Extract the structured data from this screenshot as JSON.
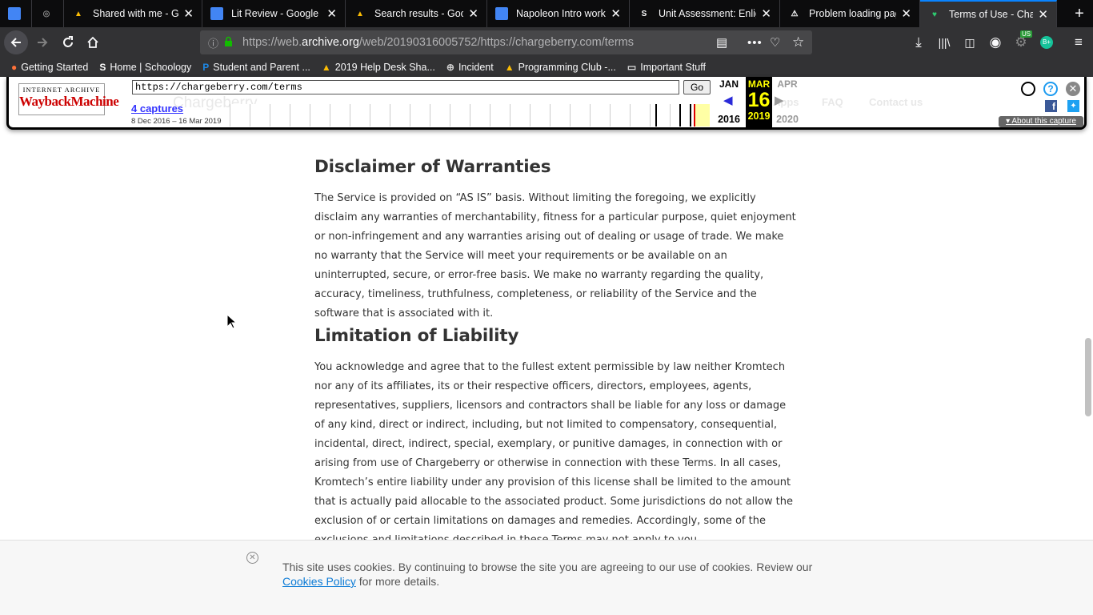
{
  "tabs": [
    {
      "title": "",
      "icon": "docs-icon",
      "color": "#4285f4"
    },
    {
      "title": "",
      "icon": "circle-logo-icon",
      "color": "#888"
    },
    {
      "title": "Shared with me - Goog",
      "icon": "drive-icon",
      "color": "#fbbc04"
    },
    {
      "title": "Lit Review - Google Do",
      "icon": "docs-icon",
      "color": "#4285f4"
    },
    {
      "title": "Search results - Googl",
      "icon": "drive-icon",
      "color": "#fbbc04"
    },
    {
      "title": "Napoleon Intro worksh",
      "icon": "docs-icon",
      "color": "#4285f4"
    },
    {
      "title": "Unit Assessment: Enlig",
      "icon": "schoology-icon",
      "color": "#fff"
    },
    {
      "title": "Problem loading page",
      "icon": "warning-icon",
      "color": "#fff"
    },
    {
      "title": "Terms of Use - Charge",
      "icon": "chargeberry-icon",
      "color": "#2ecc71"
    }
  ],
  "address": {
    "prefix": "https://web.",
    "domain": "archive.org",
    "suffix": "/web/20190316005752/https://chargeberry.com/terms"
  },
  "bookmarks": [
    {
      "label": "Getting Started",
      "icon": "firefox-icon",
      "color": "#ff7139"
    },
    {
      "label": "Home | Schoology",
      "icon": "schoology-icon",
      "color": "#fff"
    },
    {
      "label": "Student and Parent ...",
      "icon": "p-icon",
      "color": "#1e88e5"
    },
    {
      "label": "2019 Help Desk Sha...",
      "icon": "drive-icon",
      "color": "#fbbc04"
    },
    {
      "label": "Incident",
      "icon": "globe-icon",
      "color": "#ccc"
    },
    {
      "label": "Programming Club -...",
      "icon": "drive-icon",
      "color": "#fbbc04"
    },
    {
      "label": "Important Stuff",
      "icon": "folder-icon",
      "color": "#ddd"
    }
  ],
  "extension_badge": "US",
  "wayback": {
    "logo_line1": "INTERNET ARCHIVE",
    "logo_line2": "WaybackMachine",
    "url_value": "https://chargeberry.com/terms",
    "go": "Go",
    "captures": "4 captures",
    "capture_range": "8 Dec 2016 – 16 Mar 2019",
    "prev_month": "JAN",
    "cur_month": "MAR",
    "next_month": "APR",
    "day": "16",
    "prev_year": "2016",
    "cur_year": "2019",
    "next_year": "2020",
    "about": "About this capture",
    "ghost_brand": "Chargeberry",
    "ghost_nav": [
      "Apps",
      "FAQ",
      "Contact us"
    ]
  },
  "content": {
    "h1": "Disclaimer of Warranties",
    "p1": "The Service is provided on “AS IS” basis. Without limiting the foregoing, we explicitly disclaim any warranties of merchantability, fitness for a particular purpose, quiet enjoyment or non-infringement and any warranties arising out of dealing or usage of trade. We make no warranty that the Service will meet your requirements or be available on an uninterrupted, secure, or error-free basis. We make no warranty regarding the quality, accuracy, timeliness, truthfulness, completeness, or reliability of the Service and the software that is associated with it.",
    "h2": "Limitation of Liability",
    "p2": "You acknowledge and agree that to the fullest extent permissible by law neither Kromtech nor any of its affiliates, its or their respective officers, directors, employees, agents, representatives, suppliers, licensors and contractors shall be liable for any loss or damage of any kind, direct or indirect, including, but not limited to compensatory, consequential, incidental, direct, indirect, special, exemplary, or punitive damages, in connection with or arising from use of Chargeberry or otherwise in connection with these Terms. In all cases, Kromtech’s entire liability under any provision of this license shall be limited to the amount that is actually paid allocable to the associated product. Some jurisdictions do not allow the exclusion of or certain limitations on damages and remedies. Accordingly, some of the exclusions and limitations described in these Terms may not apply to you."
  },
  "cookie": {
    "text1": "This site uses cookies. By continuing to browse the site you are agreeing to our use of cookies. Review our",
    "link": "Cookies Policy",
    "text2": "for more details."
  }
}
